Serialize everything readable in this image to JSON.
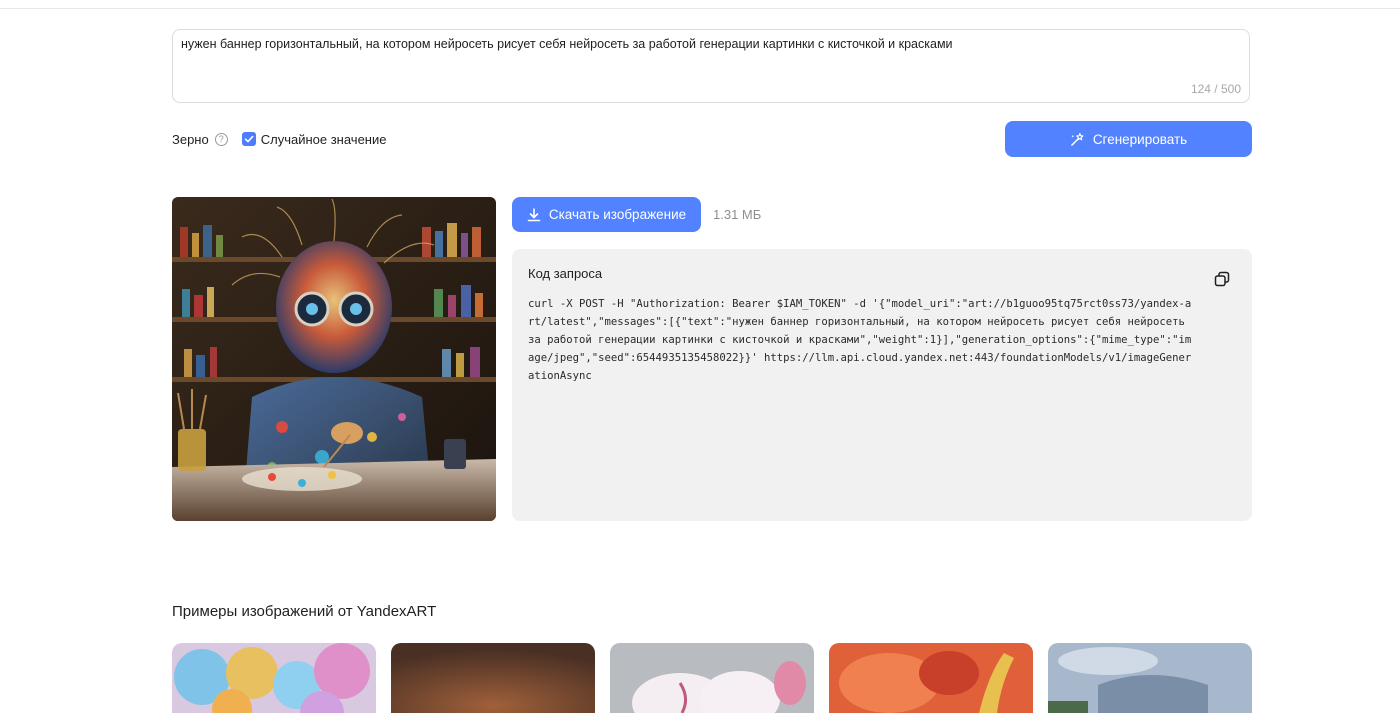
{
  "prompt": {
    "text": "нужен баннер горизонтальный, на котором нейросеть рисует себя нейросеть за работой генерации картинки с кисточкой и красками",
    "counter": "124 / 500"
  },
  "seed": {
    "label": "Зерно",
    "help": "?",
    "random_label": "Случайное значение",
    "random_checked": true
  },
  "generate_label": "Сгенерировать",
  "result": {
    "download_label": "Скачать изображение",
    "file_size": "1.31 МБ"
  },
  "code": {
    "title": "Код запроса",
    "text": "curl -X POST -H \"Authorization: Bearer $IAM_TOKEN\" -d '{\"model_uri\":\"art://b1guoo95tq75rct0ss73/yandex-art/latest\",\"messages\":[{\"text\":\"нужен баннер горизонтальный, на котором нейросеть рисует себя нейросеть за работой генерации картинки с кисточкой и красками\",\"weight\":1}],\"generation_options\":{\"mime_type\":\"image/jpeg\",\"seed\":6544935135458022}}' https://llm.api.cloud.yandex.net:443/foundationModels/v1/imageGenerationAsync"
  },
  "examples": {
    "title": "Примеры изображений от YandexART"
  },
  "colors": {
    "accent": "#5282ff",
    "panel": "#f1f1f1"
  }
}
